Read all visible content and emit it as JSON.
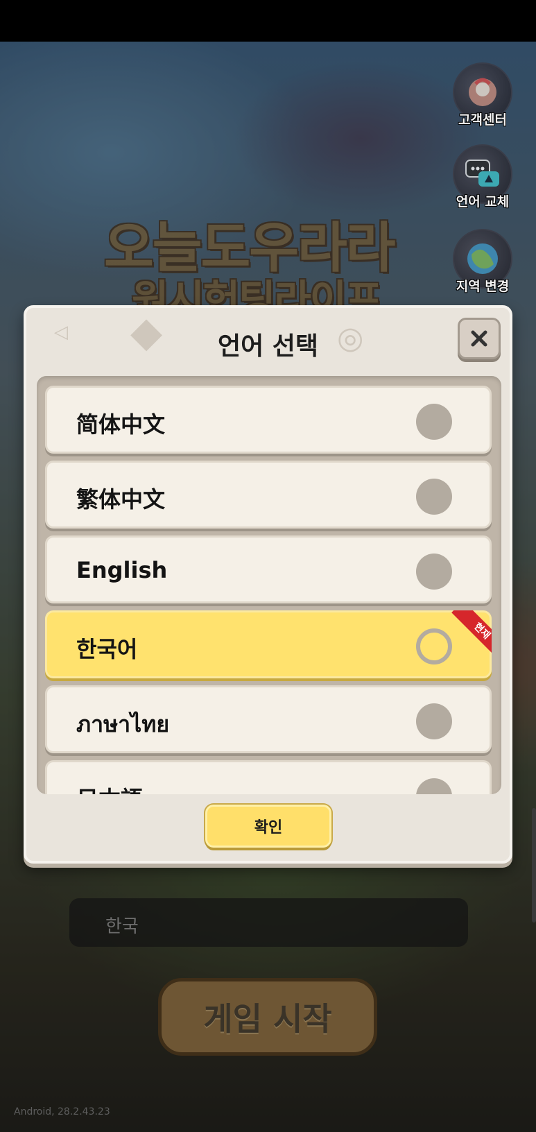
{
  "side_menu": {
    "customer_center": "고객센터",
    "language_change": "언어 교체",
    "region_change": "지역 변경"
  },
  "logo": {
    "line1": "오늘도우라라",
    "line2": "원시헌팅라이프"
  },
  "language_dialog": {
    "title": "언어 선택",
    "options": [
      {
        "label": "简体中文",
        "selected": false
      },
      {
        "label": "繁体中文",
        "selected": false
      },
      {
        "label": "English",
        "selected": false
      },
      {
        "label": "한국어",
        "selected": true,
        "badge": "현재"
      },
      {
        "label": "ภาษาไทย",
        "selected": false
      },
      {
        "label": "日本語",
        "selected": false
      }
    ],
    "confirm_label": "확인"
  },
  "region_field": {
    "value": "한국"
  },
  "start_button_label": "게임 시작",
  "version": "Android, 28.2.43.23",
  "colors": {
    "selected_option": "#ffe26e",
    "current_badge": "#d6262b",
    "dialog_bg": "#e9e4dc"
  },
  "icons": [
    "customer-center-icon",
    "language-icon",
    "region-icon",
    "close-icon"
  ]
}
